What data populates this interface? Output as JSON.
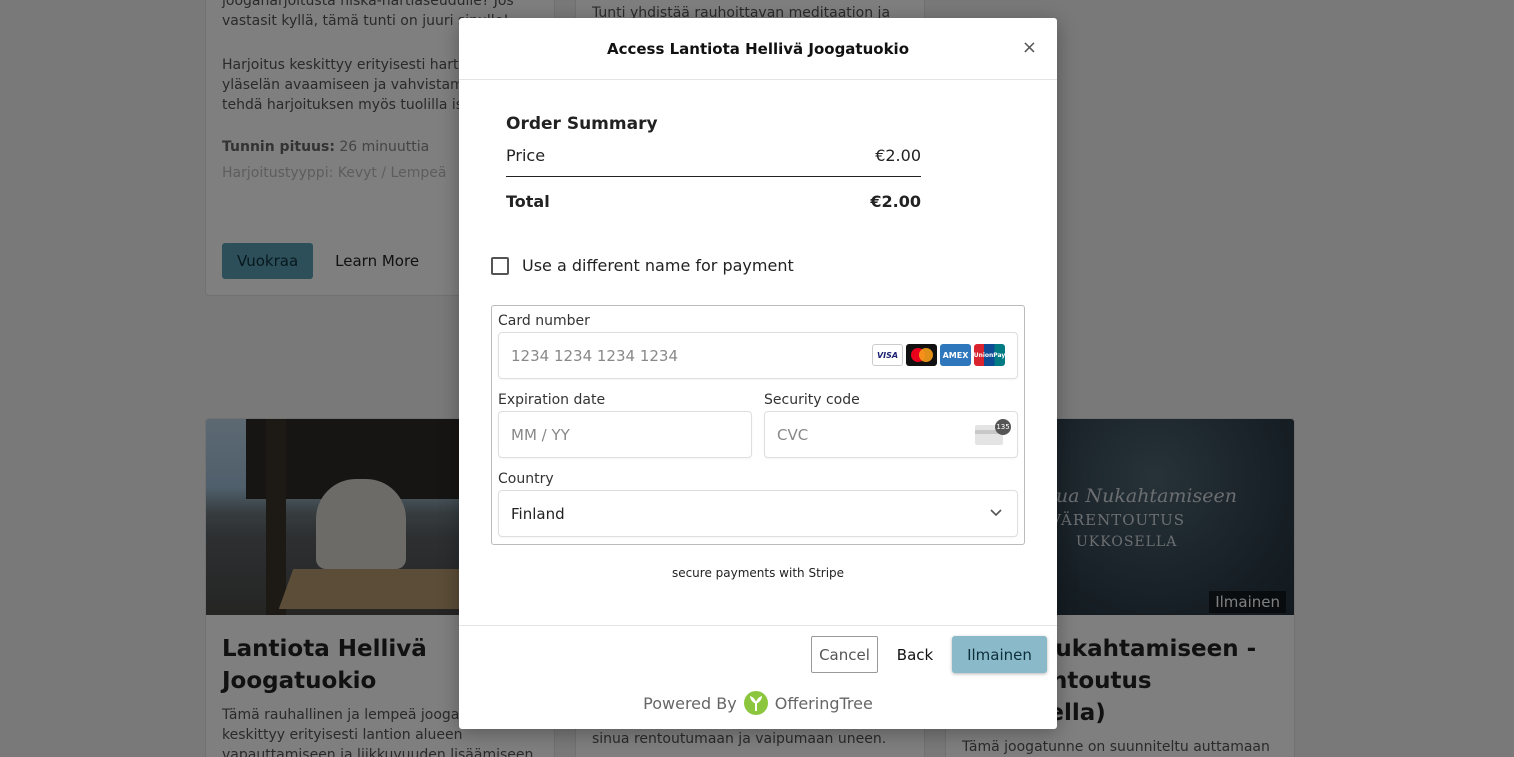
{
  "background": {
    "top_left_card": {
      "text1": "joogaharjoitusta niska-hartiaseudulle? Jos vastasit kyllä, tämä tunti on juuri sinulle!",
      "text2": "Harjoitus keskittyy erityisesti hartioiden ja yläselän avaamiseen ja vahvistamiseen. Voit tehdä harjoituksen myös tuolilla istuen.",
      "meta_label": "Tunnin pituus:",
      "meta_value": "26 minuuttia",
      "meta2": "Harjoitustyyppi: Kevyt / Lempeä",
      "rent_label": "Vuokraa",
      "learn_label": "Learn More"
    },
    "top_mid_card": {
      "text": "Tunti yhdistää rauhoittavan meditaation ja"
    },
    "bottom_left_card": {
      "title": "Lantiota Hellivä Joogatuokio",
      "text": "Tämä rauhallinen ja lempeä joogaharjoitus keskittyy erityisesti lantion alueen vapauttamiseen ja liikkuvuuden lisäämiseen. Harjoitus auttaa venyttämään"
    },
    "bottom_mid_card": {
      "text": "sinua rentoutumaan ja vaipumaan uneen."
    },
    "bottom_right_card": {
      "image_line1": "Apua Nukahtamiseen",
      "image_line2": "SYVÄRENTOUTUS",
      "image_line3": "UKKOSELLA",
      "tag": "Ilmainen",
      "title": "Apua Nukahtamiseen - Syvärentoutus (ukkosella)",
      "text": "Tämä joogatunne on suunniteltu auttamaan sinua rentoutumaan ja vaipumaan uneen"
    }
  },
  "modal": {
    "title": "Access Lantiota Hellivä Joogatuokio",
    "close_symbol": "×",
    "summary": {
      "heading": "Order Summary",
      "price_label": "Price",
      "price_value": "€2.00",
      "total_label": "Total",
      "total_value": "€2.00"
    },
    "alt_name_label": "Use a different name for payment",
    "payment": {
      "card_label": "Card number",
      "card_placeholder": "1234 1234 1234 1234",
      "brands": [
        "VISA",
        "Mastercard",
        "AMEX",
        "UnionPay"
      ],
      "expiry_label": "Expiration date",
      "expiry_placeholder": "MM / YY",
      "cvc_label": "Security code",
      "cvc_placeholder": "CVC",
      "cvc_hint": "135",
      "country_label": "Country",
      "country_value": "Finland"
    },
    "secure_text": "secure payments with Stripe",
    "buttons": {
      "cancel": "Cancel",
      "back": "Back",
      "primary": "Ilmainen"
    },
    "powered_by": "Powered By",
    "brand_name": "OfferingTree",
    "colors": {
      "primary_button": "#8ab9c9",
      "rent_button": "#5b9fb5",
      "logo_green": "#8cc63f"
    }
  }
}
